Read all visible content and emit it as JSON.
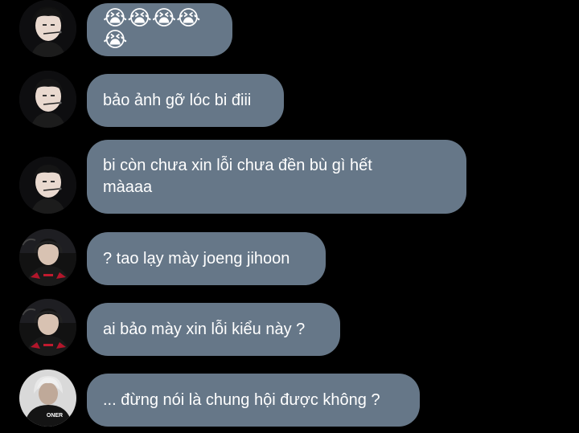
{
  "colors": {
    "background": "#000000",
    "bubble": "#667788",
    "text": "#ffffff"
  },
  "messages": [
    {
      "sender": "avatar-a",
      "text": "😭😭😭😭😭"
    },
    {
      "sender": "avatar-a",
      "text": "bảo ảnh gỡ lóc bi điii"
    },
    {
      "sender": "avatar-a",
      "text": "bi còn chưa xin lỗi chưa đền bù gì hết màaaa"
    },
    {
      "sender": "avatar-b",
      "text": "? tao lạy mày joeng jihoon"
    },
    {
      "sender": "avatar-b",
      "text": "ai bảo mày xin lỗi kiểu này ?"
    },
    {
      "sender": "avatar-c",
      "text": "... đừng nói là chung hội được không ?"
    }
  ],
  "jersey_text": "ONER"
}
